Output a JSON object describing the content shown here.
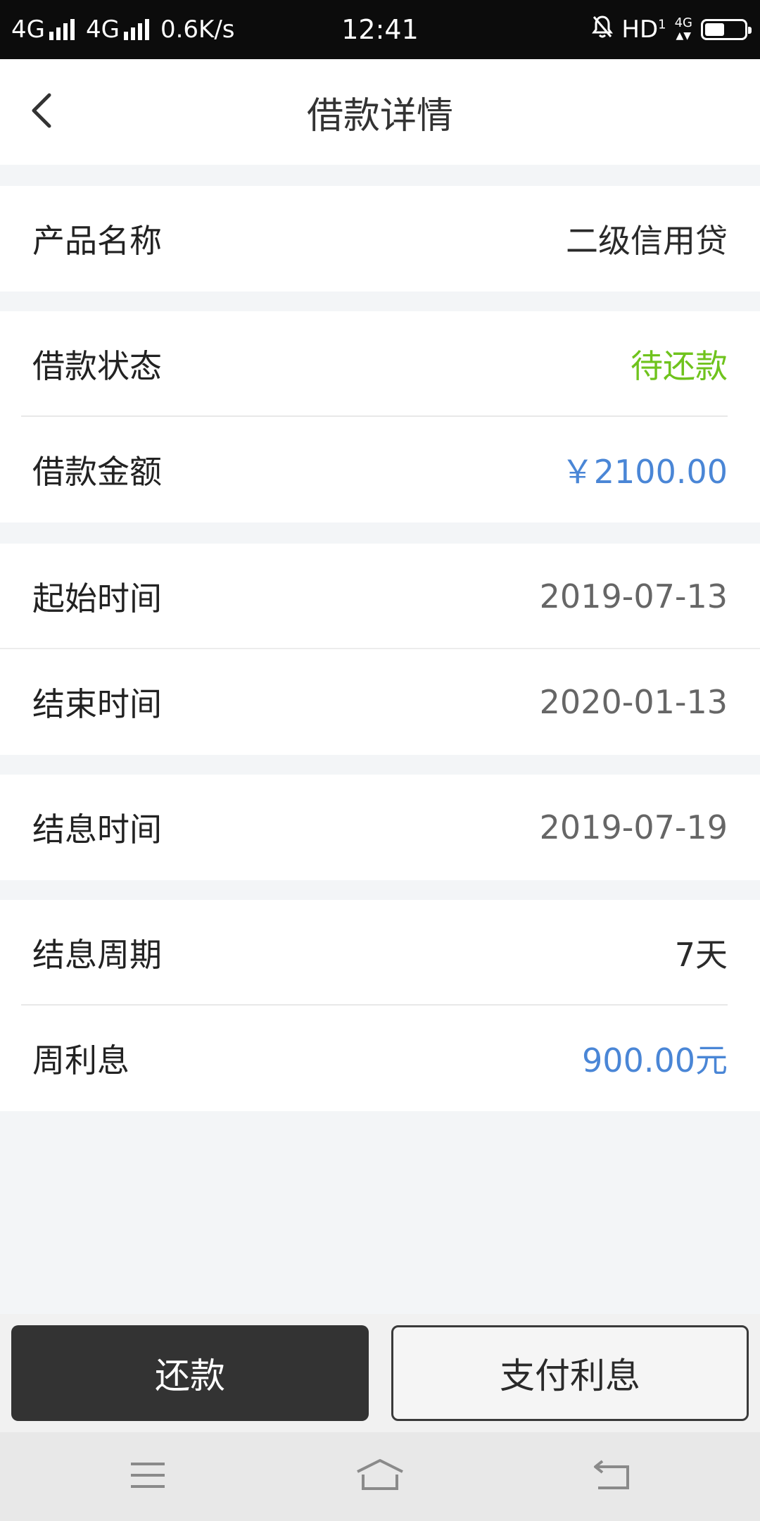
{
  "status_bar": {
    "network_1": "4G",
    "network_2": "4G",
    "speed": "0.6K/s",
    "time": "12:41",
    "hd": "HD",
    "hd_sub": "1",
    "mini_net": "4G",
    "battery_level": 0.5
  },
  "header": {
    "title": "借款详情",
    "back_icon": "chevron-left-icon"
  },
  "details": {
    "product_name": {
      "label": "产品名称",
      "value": "二级信用贷"
    },
    "loan_status": {
      "label": "借款状态",
      "value": "待还款",
      "color": "#6fc31d"
    },
    "loan_amount": {
      "label": "借款金额",
      "value": "￥2100.00",
      "color": "#4a86d6"
    },
    "start_time": {
      "label": "起始时间",
      "value": "2019-07-13"
    },
    "end_time": {
      "label": "结束时间",
      "value": "2020-01-13"
    },
    "settle_time": {
      "label": "结息时间",
      "value": "2019-07-19"
    },
    "settle_period": {
      "label": "结息周期",
      "value": "7天"
    },
    "weekly_interest": {
      "label": "周利息",
      "value": "900.00元",
      "color": "#4a86d6"
    }
  },
  "actions": {
    "repay_label": "还款",
    "pay_interest_label": "支付利息"
  },
  "nav_bar": {
    "menu_icon": "menu-icon",
    "home_icon": "home-icon",
    "back_icon": "back-icon"
  }
}
